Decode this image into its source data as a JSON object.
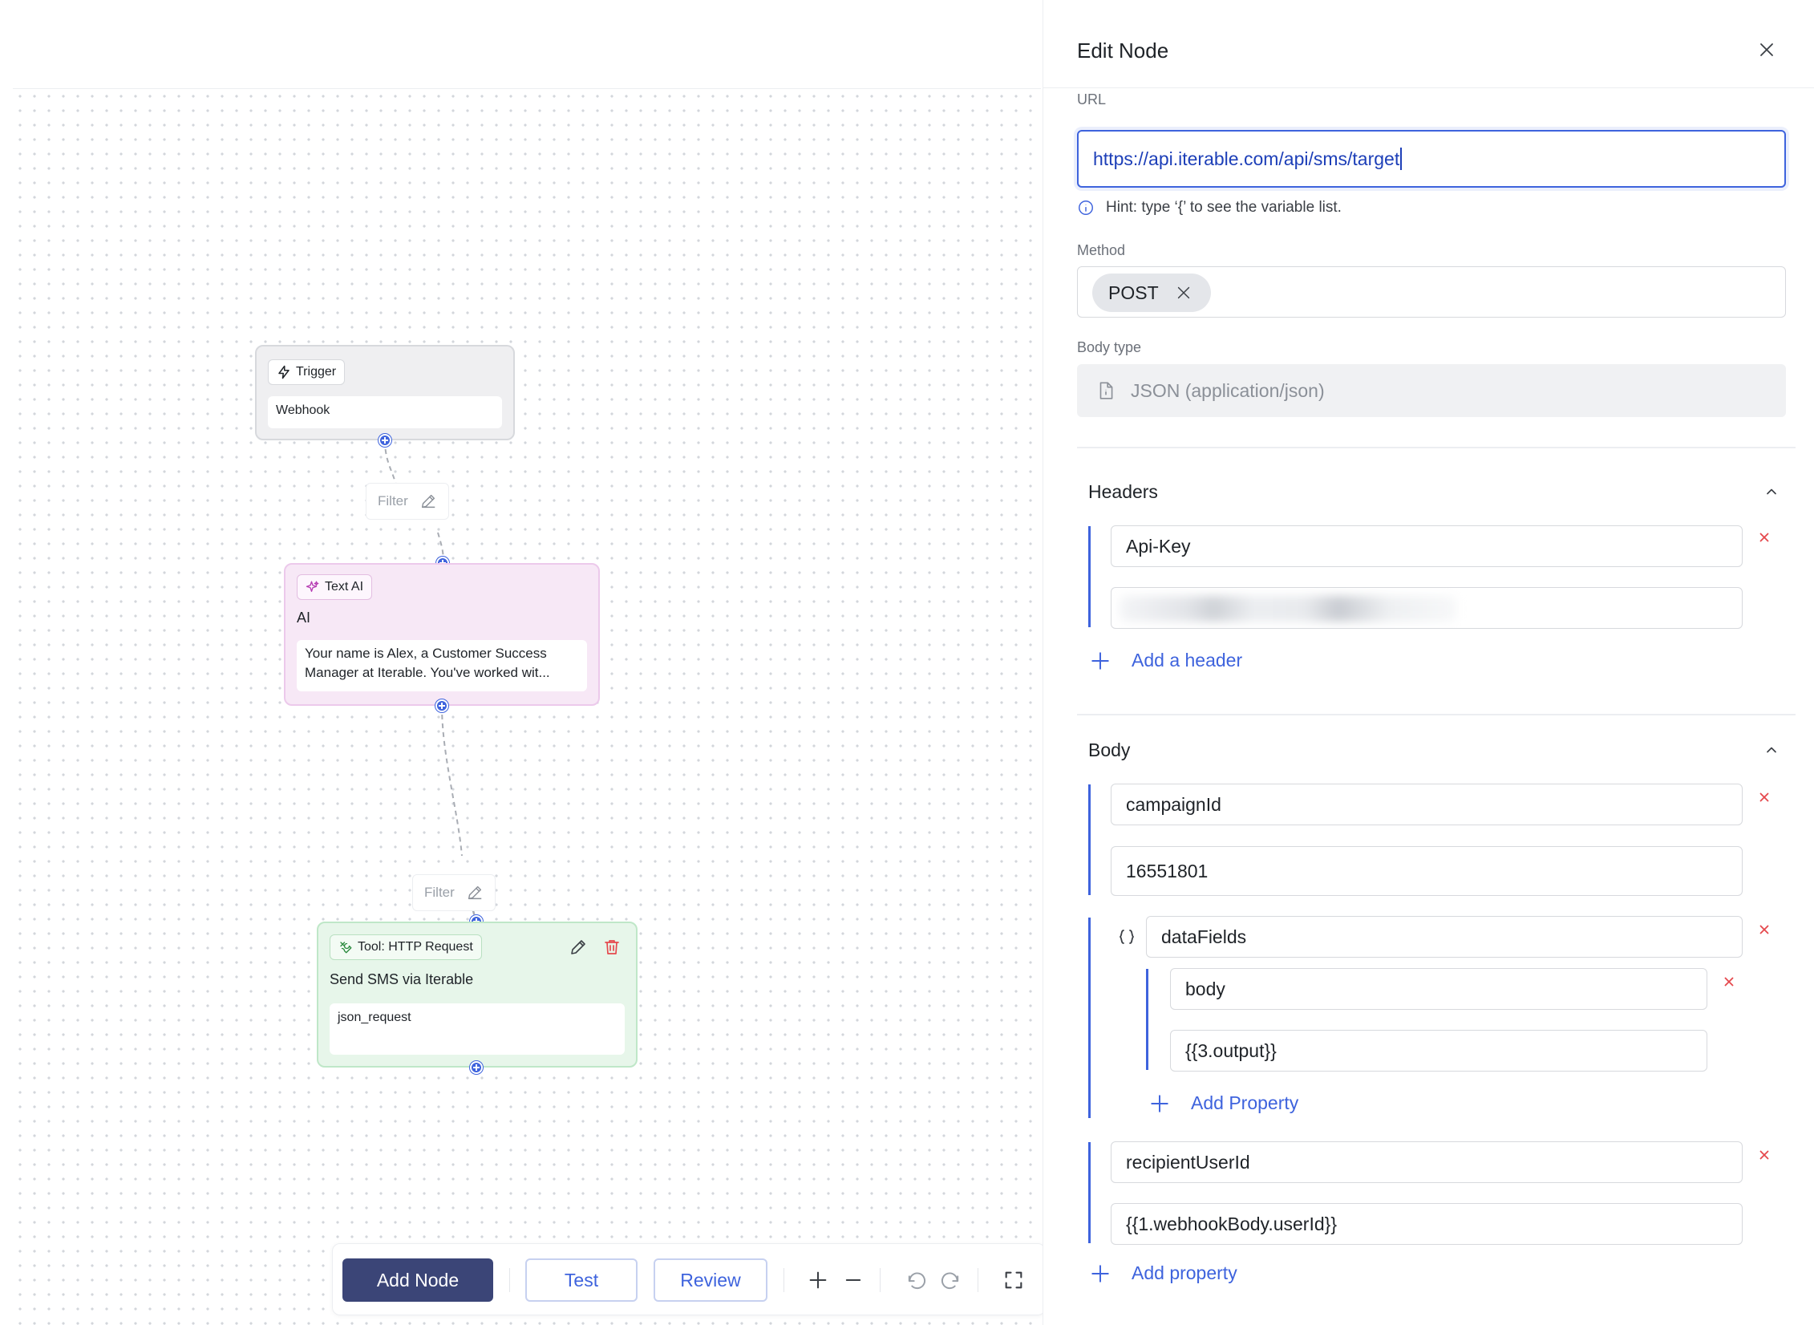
{
  "canvas": {
    "nodes": {
      "trigger": {
        "badge": "Trigger",
        "value": "Webhook"
      },
      "text_ai": {
        "badge": "Text AI",
        "title": "AI",
        "prompt_line1": "Your name is Alex, a Customer Success",
        "prompt_line2": "Manager at Iterable. You've worked wit..."
      },
      "tool": {
        "badge": "Tool: HTTP Request",
        "title": "Send SMS via Iterable",
        "value": "json_request"
      }
    },
    "filters": [
      {
        "label": "Filter"
      },
      {
        "label": "Filter"
      }
    ]
  },
  "toolbar": {
    "add_node": "Add Node",
    "test": "Test",
    "review": "Review"
  },
  "panel": {
    "title": "Edit Node",
    "url": {
      "label": "URL",
      "value": "https://api.iterable.com/api/sms/target",
      "hint": "Hint: type ‘{’ to see the variable list."
    },
    "method": {
      "label": "Method",
      "selected": "POST"
    },
    "body_type": {
      "label": "Body type",
      "value": "JSON (application/json)"
    },
    "headers": {
      "title": "Headers",
      "items": [
        {
          "key": "Api-Key",
          "value": ""
        }
      ],
      "add_label": "Add a header"
    },
    "body": {
      "title": "Body",
      "items": [
        {
          "key": "campaignId",
          "value": "16551801"
        },
        {
          "key": "dataFields",
          "children": [
            {
              "key": "body",
              "value": "{{3.output}}"
            }
          ],
          "add_label": "Add Property"
        },
        {
          "key": "recipientUserId",
          "value": "{{1.webhookBody.userId}}"
        }
      ],
      "add_label": "Add property"
    }
  },
  "colors": {
    "accent": "#3e63dd",
    "primary_button": "#3b4577",
    "remove": "#e5484d",
    "trigger_node": "#efeff1",
    "ai_node": "#f7e8f6",
    "tool_node": "#e7f6ea"
  }
}
